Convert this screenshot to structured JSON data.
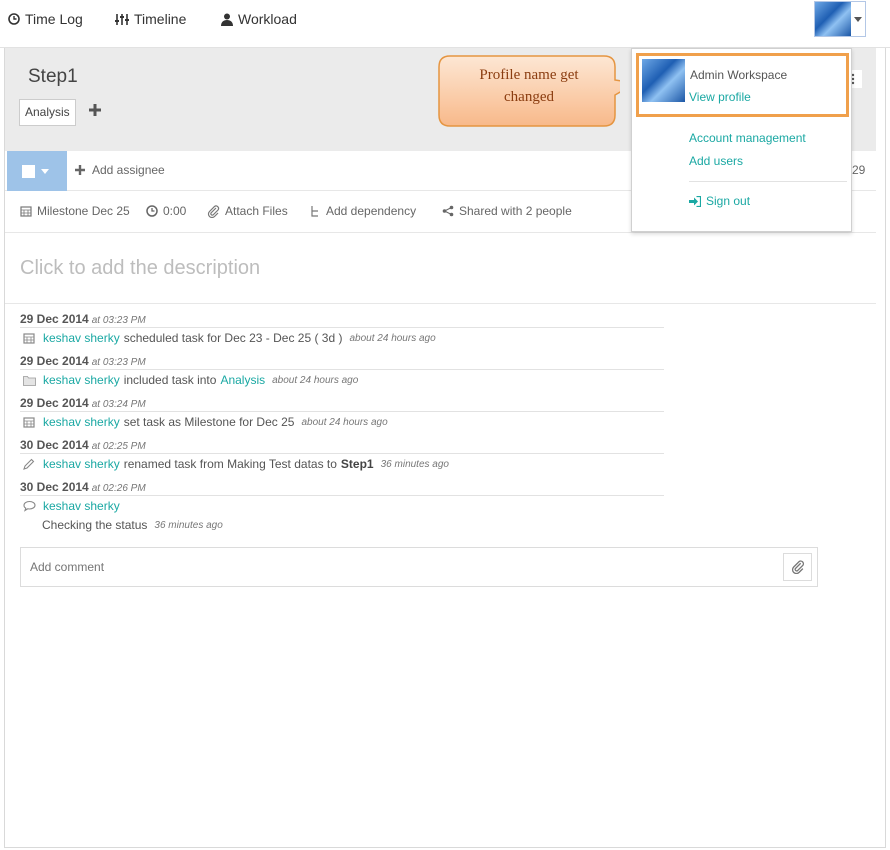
{
  "nav": {
    "items": [
      {
        "label": "Time Log",
        "icon": "clock-icon"
      },
      {
        "label": "Timeline",
        "icon": "sliders-icon"
      },
      {
        "label": "Workload",
        "icon": "user-icon"
      }
    ]
  },
  "task": {
    "title": "Step1",
    "tag": "Analysis",
    "add_assignee": "Add assignee",
    "count": "29",
    "meta": {
      "milestone": "Milestone Dec 25",
      "time": "0:00",
      "attach": "Attach Files",
      "dependency": "Add dependency",
      "shared": "Shared with 2 people"
    },
    "description_placeholder": "Click to add the description"
  },
  "activity": [
    {
      "date": "29 Dec 2014",
      "at": "at 03:23 PM",
      "user": "keshav sherky",
      "text": "scheduled task for Dec 23 - Dec 25 ( 3d )",
      "ago": "about 24 hours ago",
      "icon": "calendar-icon"
    },
    {
      "date": "29 Dec 2014",
      "at": "at 03:23 PM",
      "user": "keshav sherky",
      "text": "included task into",
      "link": "Analysis",
      "ago": "about 24 hours ago",
      "icon": "folder-icon"
    },
    {
      "date": "29 Dec 2014",
      "at": "at 03:24 PM",
      "user": "keshav sherky",
      "text": "set task as Milestone for Dec 25",
      "ago": "about 24 hours ago",
      "icon": "calendar-icon"
    },
    {
      "date": "30 Dec 2014",
      "at": "at 02:25 PM",
      "user": "keshav sherky",
      "text": "renamed task from Making Test datas to",
      "bold": "Step1",
      "ago": "36 minutes ago",
      "icon": "pencil-icon"
    },
    {
      "date": "30 Dec 2014",
      "at": "at 02:26 PM",
      "user": "keshav sherky",
      "comment": "Checking the status",
      "ago": "36 minutes ago",
      "icon": "comment-icon"
    }
  ],
  "comment": {
    "placeholder": "Add comment"
  },
  "profile_menu": {
    "name": "Admin Workspace",
    "view_profile": "View profile",
    "account_management": "Account management",
    "add_users": "Add users",
    "sign_out": "Sign out"
  },
  "callout": {
    "line1": "Profile name get",
    "line2": "changed"
  },
  "colors": {
    "link": "#1aa8a3",
    "highlight": "#f0a04b",
    "callout_fill": "#fbd3b4",
    "callout_text": "#8b3d10",
    "assign_bg": "#9ec3e8"
  }
}
